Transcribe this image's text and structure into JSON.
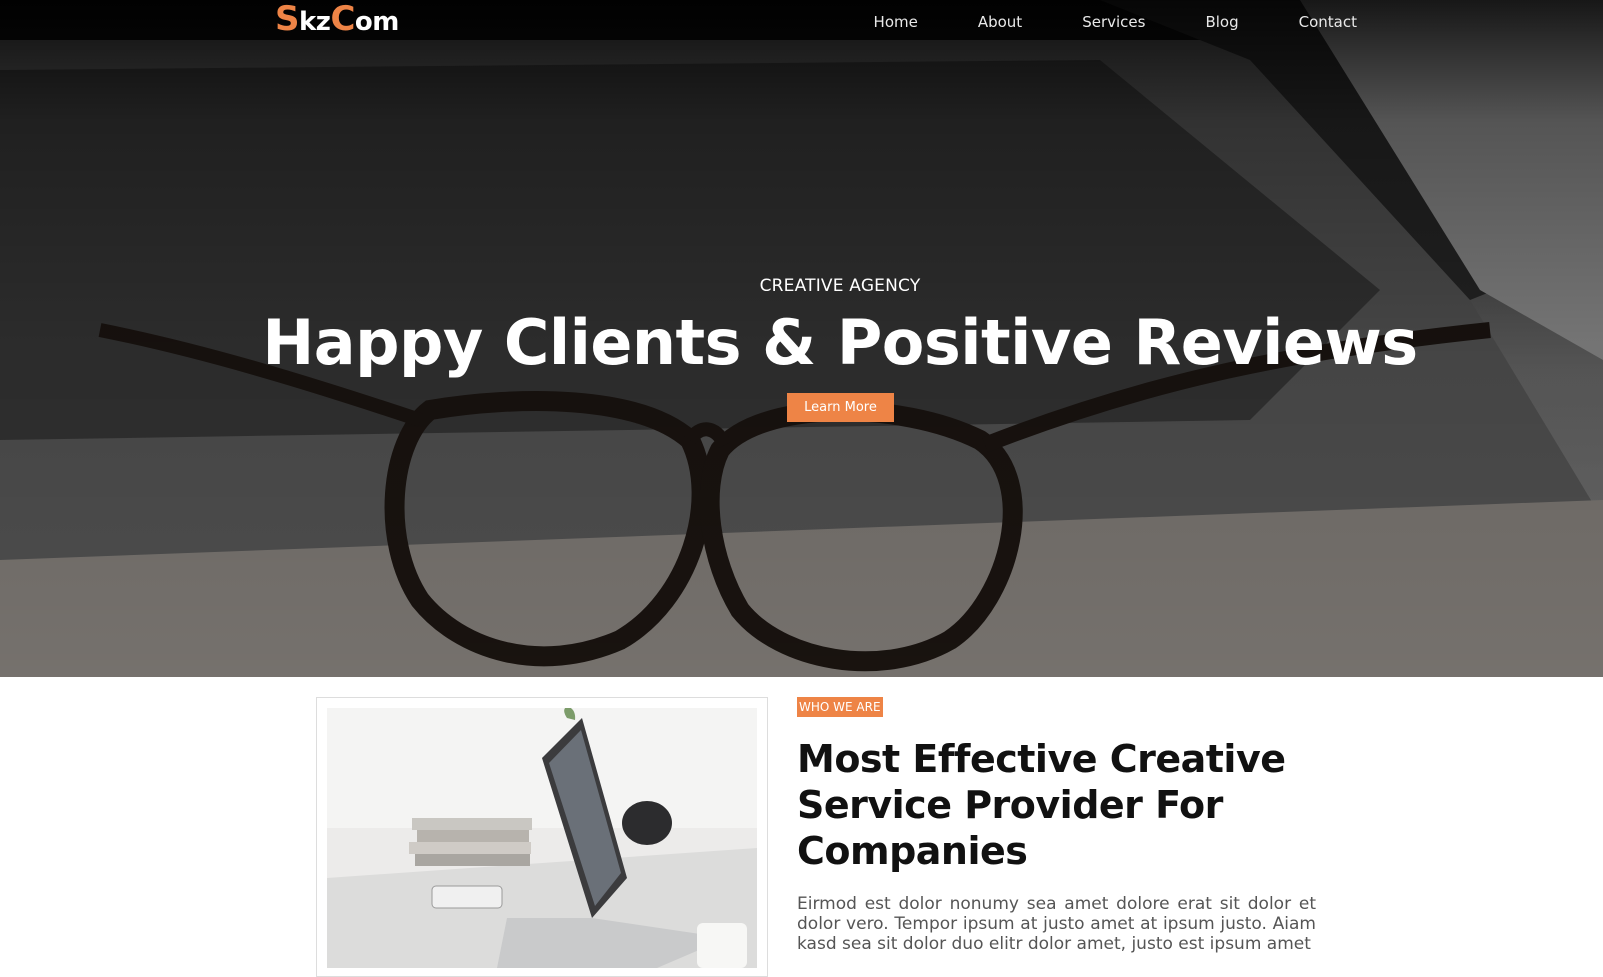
{
  "brand": {
    "logo_s": "S",
    "logo_kz": "kz",
    "logo_c": "C",
    "logo_om": "om",
    "accent_color": "#ee8446"
  },
  "nav": {
    "items": [
      {
        "label": "Home"
      },
      {
        "label": "About"
      },
      {
        "label": "Services"
      },
      {
        "label": "Blog"
      },
      {
        "label": "Contact"
      }
    ]
  },
  "hero": {
    "subtitle": "CREATIVE AGENCY",
    "title": "Happy Clients & Positive Reviews",
    "button_label": "Learn More"
  },
  "about": {
    "badge": "WHO WE ARE",
    "title": "Most Effective Creative Service Provider For Companies",
    "text": "Eirmod est dolor nonumy sea amet dolore erat sit dolor et dolor vero. Tempor ipsum at justo amet at ipsum justo. Aiam kasd sea sit dolor duo elitr dolor amet, justo est ipsum amet"
  }
}
